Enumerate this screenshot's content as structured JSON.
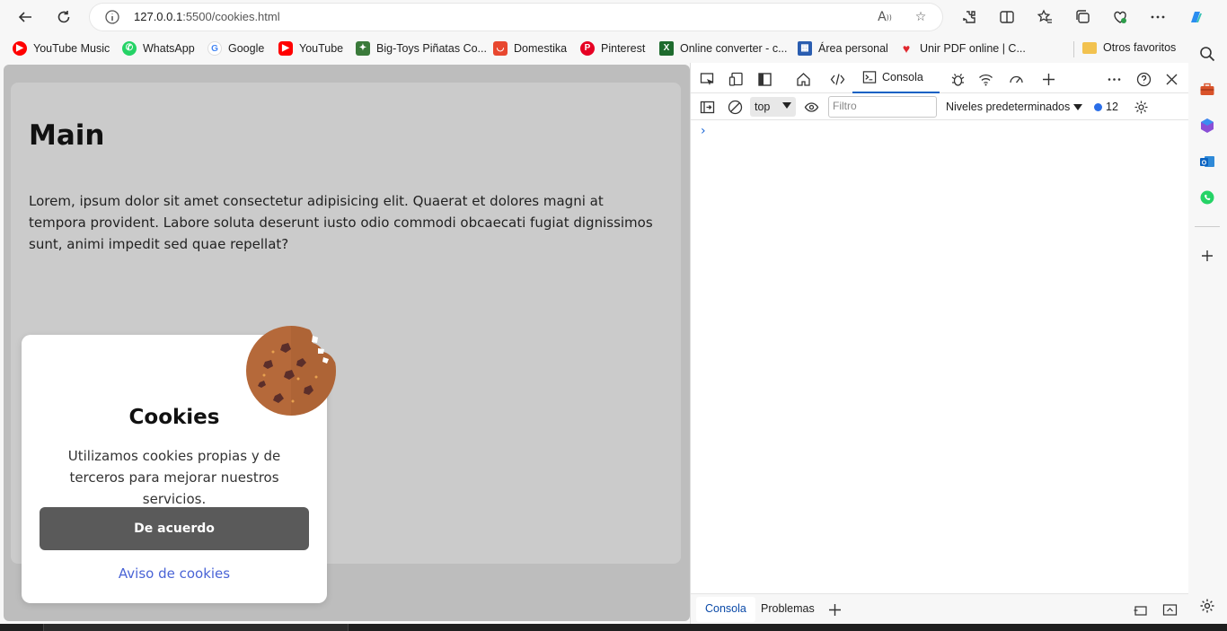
{
  "browser": {
    "url_host": "127.0.0.1",
    "url_path": ":5500/cookies.html",
    "bookmarks": [
      {
        "label": "YouTube Music",
        "icon": "youtube-music-icon",
        "color": "#ff0000"
      },
      {
        "label": "WhatsApp",
        "icon": "whatsapp-icon",
        "color": "#25d366"
      },
      {
        "label": "Google",
        "icon": "google-icon",
        "color": "#4285f4"
      },
      {
        "label": "YouTube",
        "icon": "youtube-icon",
        "color": "#ff0000"
      },
      {
        "label": "Big-Toys Piñatas Co...",
        "icon": "pinata-icon",
        "color": "#3a7a3a"
      },
      {
        "label": "Domestika",
        "icon": "domestika-icon",
        "color": "#e8472f"
      },
      {
        "label": "Pinterest",
        "icon": "pinterest-icon",
        "color": "#e60023"
      },
      {
        "label": "Online converter - c...",
        "icon": "converter-icon",
        "color": "#1e6b2e"
      },
      {
        "label": "Área personal",
        "icon": "area-personal-icon",
        "color": "#2a5db0"
      },
      {
        "label": "Unir PDF online | C...",
        "icon": "heart-pdf-icon",
        "color": "#e0282e"
      },
      {
        "label": "Otros favoritos",
        "icon": "folder-icon",
        "color": "#f2c24f"
      }
    ]
  },
  "page": {
    "main_title": "Main",
    "main_text": "Lorem, ipsum dolor sit amet consectetur adipisicing elit. Quaerat et dolores magni at tempora provident. Labore soluta deserunt iusto odio commodi obcaecati fugiat dignissimos sunt, animi impedit sed quae repellat?",
    "cookie_title": "Cookies",
    "cookie_text": "Utilizamos cookies propias y de terceros para mejorar nuestros servicios.",
    "cookie_button": "De acuerdo",
    "cookie_link": "Aviso de cookies"
  },
  "devtools": {
    "console_tab": "Consola",
    "context": "top",
    "filter_placeholder": "Filtro",
    "levels": "Niveles predeterminados",
    "message_count": "12",
    "bottom_tabs": [
      "Consola",
      "Problemas"
    ]
  }
}
